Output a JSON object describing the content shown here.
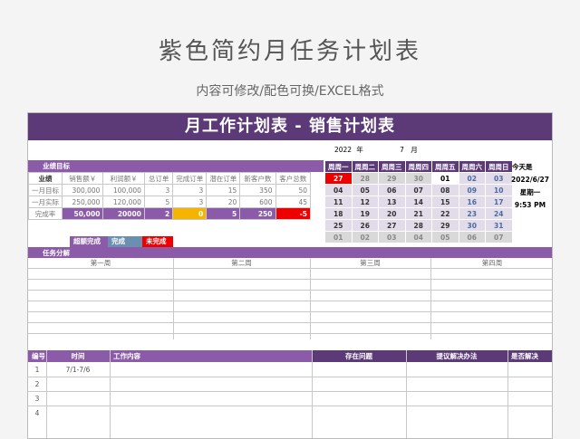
{
  "page": {
    "title": "紫色简约月任务计划表",
    "subtitle": "内容可修改/配色可换/EXCEL格式"
  },
  "sheet": {
    "banner": "月工作计划表 - 销售计划表",
    "year": "2022",
    "year_label": "年",
    "month": "7",
    "month_label": "月",
    "target_section": "业绩目标",
    "target_headers": [
      "业绩",
      "销售额￥",
      "利润额￥",
      "总订单",
      "完成订单",
      "潜在订单",
      "新客户数",
      "客户总数"
    ],
    "target_rows": [
      [
        "一月目标",
        "300,000",
        "100,000",
        "3",
        "3",
        "15",
        "350",
        "50"
      ],
      [
        "一月实际",
        "250,000",
        "120,000",
        "5",
        "3",
        "20",
        "600",
        "45"
      ],
      [
        "完成率",
        "50,000",
        "20000",
        "2",
        "0",
        "5",
        "250",
        "-5"
      ]
    ],
    "legend": [
      "超额完成",
      "完成",
      "未完成"
    ],
    "calendar_headers": [
      "周周一",
      "周周二",
      "周周三",
      "周周四",
      "周周五",
      "周周六",
      "周周日"
    ],
    "calendar_rows": [
      [
        "27",
        "28",
        "29",
        "30",
        "01",
        "02",
        "03"
      ],
      [
        "04",
        "05",
        "06",
        "07",
        "08",
        "09",
        "10"
      ],
      [
        "11",
        "12",
        "13",
        "14",
        "15",
        "16",
        "17"
      ],
      [
        "18",
        "19",
        "20",
        "21",
        "22",
        "23",
        "24"
      ],
      [
        "25",
        "26",
        "27",
        "28",
        "29",
        "30",
        "31"
      ],
      [
        "01",
        "02",
        "03",
        "04",
        "05",
        "06",
        "07"
      ]
    ],
    "today_label": "今天是",
    "today_date": "2022/6/27",
    "today_weekday": "星期一",
    "today_time": "9:53 PM",
    "task_section": "任务分解",
    "weeks": [
      "第一周",
      "第二周",
      "第三周",
      "第四周"
    ],
    "bottom_headers": [
      "编号",
      "时间",
      "工作内容",
      "存在问题",
      "提议解决办法",
      "是否解决"
    ],
    "bottom_rows": [
      {
        "no": "1",
        "time": "7/1-7/6"
      },
      {
        "no": "2",
        "time": ""
      },
      {
        "no": "3",
        "time": ""
      },
      {
        "no": "4",
        "time": ""
      }
    ],
    "colors": {
      "accent": "#5c3a78",
      "bar": "#8b5aa8",
      "exceed": "#8b5aa8",
      "done": "#6a8fb0",
      "fail": "#e00000",
      "yellow": "#f5b400"
    }
  }
}
